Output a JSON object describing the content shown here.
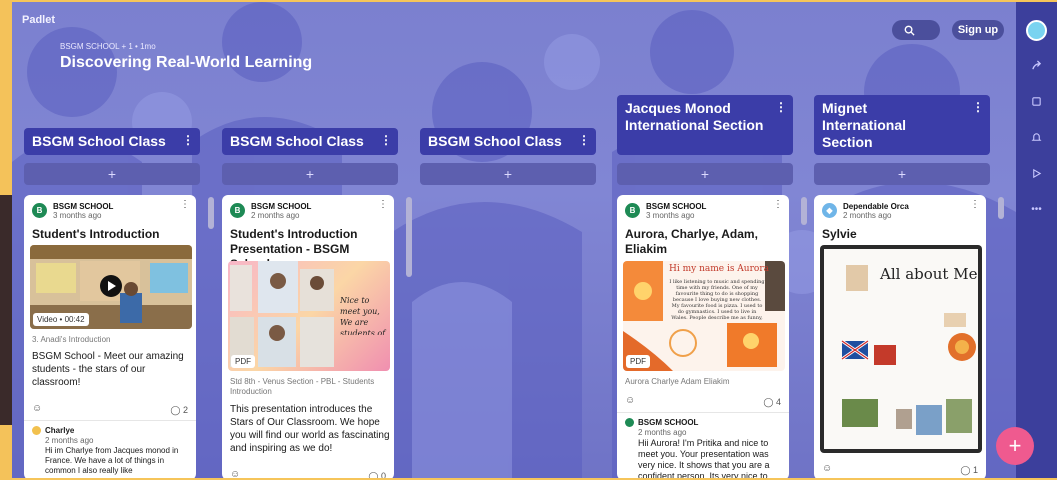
{
  "app": {
    "logo": "Padlet"
  },
  "header": {
    "meta": "BSGM SCHOOL + 1 • 1mo",
    "title": "Discovering Real-World Learning",
    "signup_label": "Sign up"
  },
  "rail": {
    "more_label": "•••"
  },
  "fab_label": "+",
  "columns": [
    {
      "title": "BSGM School Class",
      "add": "+"
    },
    {
      "title": "BSGM School Class",
      "add": "+"
    },
    {
      "title": "BSGM School Class",
      "add": "+"
    },
    {
      "title": "Jacques Monod International Section",
      "add": "+"
    },
    {
      "title": "Mignet International Section",
      "add": "+"
    }
  ],
  "cards": {
    "c1": {
      "avatar": "B",
      "author": "BSGM SCHOOL",
      "time": "3 months ago",
      "title": "Student's Introduction",
      "media_badge": "Video • 00:42",
      "caption": "3. Anadi's Introduction",
      "body": "BSGM School - Meet our amazing students - the stars of our classroom!",
      "comment_count": "2",
      "comment": {
        "author": "Charlye",
        "time": "2 months ago",
        "text": "Hi im Charlye from Jacques monod in France. We have a lot of things in common I also really like"
      }
    },
    "c2": {
      "avatar": "B",
      "author": "BSGM SCHOOL",
      "time": "2 months ago",
      "title": "Student's Introduction Presentation - BSGM School",
      "media_text": "Nice to meet you, We are students of BSGM School",
      "media_badge": "PDF",
      "caption": "Std 8th - Venus Section - PBL - Students Introduction",
      "body": "This presentation introduces the Stars of Our Classroom. We hope you will find our world as fascinating and inspiring as we do!",
      "comment_count": "0"
    },
    "c3": {
      "avatar": "B",
      "author": "BSGM SCHOOL",
      "time": "3 months ago",
      "title": "Aurora, Charlye, Adam, Eliakim",
      "media_heading": "Hi my name is Aurora",
      "media_text": "I like listening to music and spending time with my friends. One of my favourite thing to do is shopping because I love buying new clothes. My favourite food is pizza. I used to do gymnastics. I used to live in Wales. People describe me as funny, shy and kind.",
      "media_badge": "PDF",
      "caption": "Aurora Charlye Adam Eliakim",
      "comment_count": "4",
      "comment": {
        "author": "BSGM SCHOOL",
        "time": "2 months ago",
        "text": "Hii Aurora! I'm Pritika and nice to meet you. Your presentation was very nice. It shows that you are a confident person. Its very nice to"
      }
    },
    "c4": {
      "avatar": "",
      "author": "Dependable Orca",
      "time": "2 months ago",
      "title": "Sylvie",
      "media_heading": "All about Me",
      "comment_count": "1"
    }
  },
  "colors": {
    "accent": "#3b3da8",
    "fab": "#ef5a8f",
    "rail": "#3c3f9c",
    "avatar_green": "#1e8a55"
  }
}
